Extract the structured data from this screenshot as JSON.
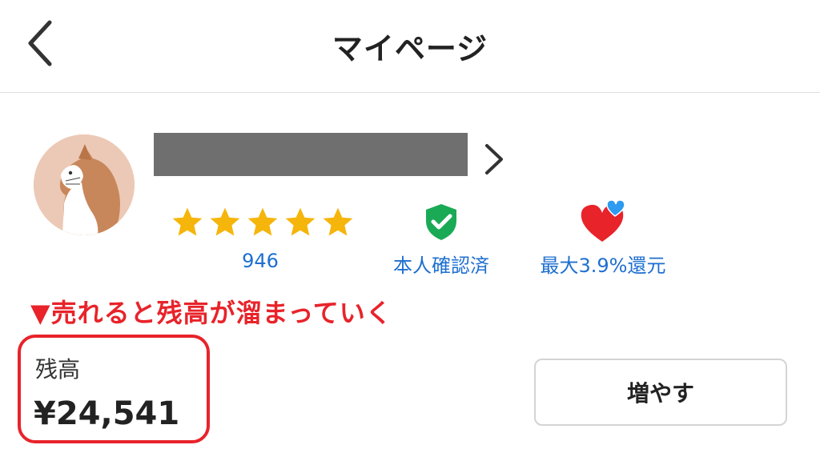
{
  "header": {
    "title": "マイページ",
    "back_icon": "chevron-left-icon"
  },
  "profile": {
    "avatar_icon": "cat-avatar-icon",
    "username_redacted": true,
    "chevron_icon": "chevron-right-icon",
    "rating": {
      "stars": 5,
      "count": "946",
      "star_color": "#f5b50a"
    },
    "verification": {
      "label": "本人確認済",
      "icon": "shield-check-icon",
      "icon_color": "#1aaa55"
    },
    "cashback": {
      "label": "最大3.9%還元",
      "icon": "heart-icon",
      "heart_color": "#e8232a",
      "accent_color": "#2f9bf0"
    }
  },
  "annotation": {
    "text": "▼売れると残高が溜まっていく",
    "color": "#e8232a"
  },
  "balance": {
    "label": "残高",
    "value": "¥24,541"
  },
  "actions": {
    "increase_label": "増やす"
  },
  "colors": {
    "link_blue": "#1e6fd0",
    "highlight_red": "#e8232a",
    "divider": "#dedede"
  }
}
